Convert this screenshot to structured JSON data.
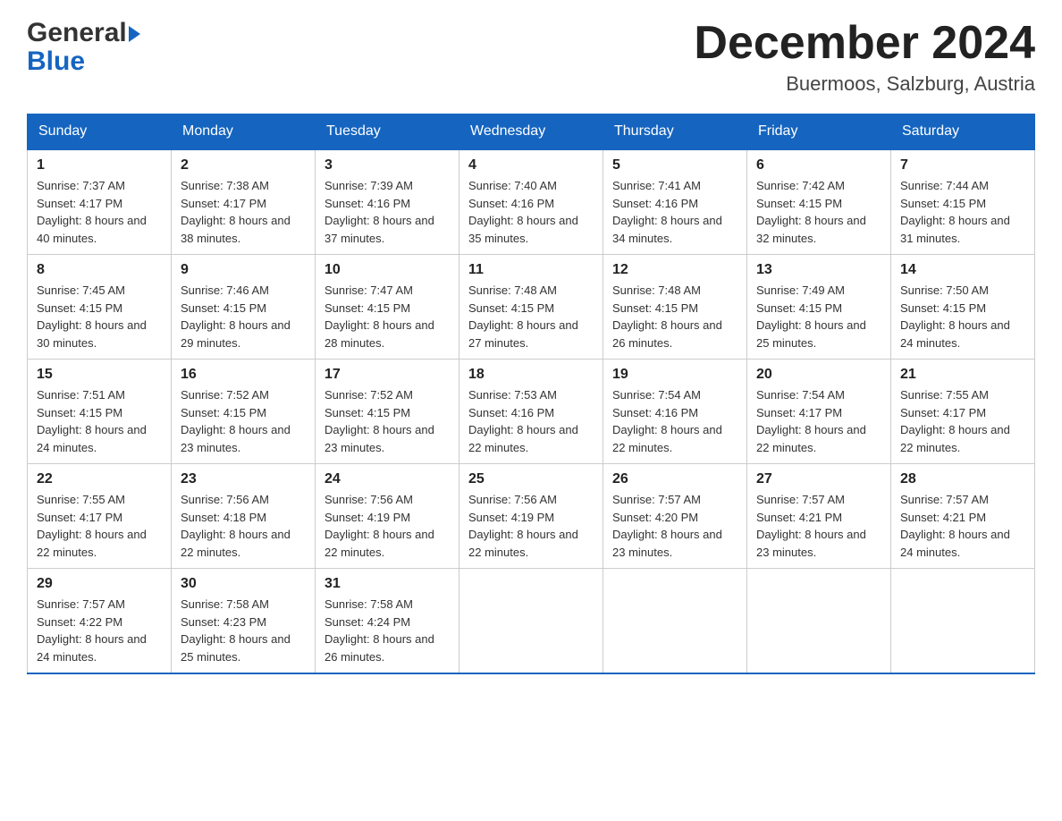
{
  "header": {
    "logo": {
      "general": "General",
      "blue": "Blue",
      "arrow": "▶"
    },
    "title": "December 2024",
    "location": "Buermoos, Salzburg, Austria"
  },
  "calendar": {
    "days_of_week": [
      "Sunday",
      "Monday",
      "Tuesday",
      "Wednesday",
      "Thursday",
      "Friday",
      "Saturday"
    ],
    "weeks": [
      [
        {
          "day": "1",
          "sunrise": "7:37 AM",
          "sunset": "4:17 PM",
          "daylight": "8 hours and 40 minutes."
        },
        {
          "day": "2",
          "sunrise": "7:38 AM",
          "sunset": "4:17 PM",
          "daylight": "8 hours and 38 minutes."
        },
        {
          "day": "3",
          "sunrise": "7:39 AM",
          "sunset": "4:16 PM",
          "daylight": "8 hours and 37 minutes."
        },
        {
          "day": "4",
          "sunrise": "7:40 AM",
          "sunset": "4:16 PM",
          "daylight": "8 hours and 35 minutes."
        },
        {
          "day": "5",
          "sunrise": "7:41 AM",
          "sunset": "4:16 PM",
          "daylight": "8 hours and 34 minutes."
        },
        {
          "day": "6",
          "sunrise": "7:42 AM",
          "sunset": "4:15 PM",
          "daylight": "8 hours and 32 minutes."
        },
        {
          "day": "7",
          "sunrise": "7:44 AM",
          "sunset": "4:15 PM",
          "daylight": "8 hours and 31 minutes."
        }
      ],
      [
        {
          "day": "8",
          "sunrise": "7:45 AM",
          "sunset": "4:15 PM",
          "daylight": "8 hours and 30 minutes."
        },
        {
          "day": "9",
          "sunrise": "7:46 AM",
          "sunset": "4:15 PM",
          "daylight": "8 hours and 29 minutes."
        },
        {
          "day": "10",
          "sunrise": "7:47 AM",
          "sunset": "4:15 PM",
          "daylight": "8 hours and 28 minutes."
        },
        {
          "day": "11",
          "sunrise": "7:48 AM",
          "sunset": "4:15 PM",
          "daylight": "8 hours and 27 minutes."
        },
        {
          "day": "12",
          "sunrise": "7:48 AM",
          "sunset": "4:15 PM",
          "daylight": "8 hours and 26 minutes."
        },
        {
          "day": "13",
          "sunrise": "7:49 AM",
          "sunset": "4:15 PM",
          "daylight": "8 hours and 25 minutes."
        },
        {
          "day": "14",
          "sunrise": "7:50 AM",
          "sunset": "4:15 PM",
          "daylight": "8 hours and 24 minutes."
        }
      ],
      [
        {
          "day": "15",
          "sunrise": "7:51 AM",
          "sunset": "4:15 PM",
          "daylight": "8 hours and 24 minutes."
        },
        {
          "day": "16",
          "sunrise": "7:52 AM",
          "sunset": "4:15 PM",
          "daylight": "8 hours and 23 minutes."
        },
        {
          "day": "17",
          "sunrise": "7:52 AM",
          "sunset": "4:15 PM",
          "daylight": "8 hours and 23 minutes."
        },
        {
          "day": "18",
          "sunrise": "7:53 AM",
          "sunset": "4:16 PM",
          "daylight": "8 hours and 22 minutes."
        },
        {
          "day": "19",
          "sunrise": "7:54 AM",
          "sunset": "4:16 PM",
          "daylight": "8 hours and 22 minutes."
        },
        {
          "day": "20",
          "sunrise": "7:54 AM",
          "sunset": "4:17 PM",
          "daylight": "8 hours and 22 minutes."
        },
        {
          "day": "21",
          "sunrise": "7:55 AM",
          "sunset": "4:17 PM",
          "daylight": "8 hours and 22 minutes."
        }
      ],
      [
        {
          "day": "22",
          "sunrise": "7:55 AM",
          "sunset": "4:17 PM",
          "daylight": "8 hours and 22 minutes."
        },
        {
          "day": "23",
          "sunrise": "7:56 AM",
          "sunset": "4:18 PM",
          "daylight": "8 hours and 22 minutes."
        },
        {
          "day": "24",
          "sunrise": "7:56 AM",
          "sunset": "4:19 PM",
          "daylight": "8 hours and 22 minutes."
        },
        {
          "day": "25",
          "sunrise": "7:56 AM",
          "sunset": "4:19 PM",
          "daylight": "8 hours and 22 minutes."
        },
        {
          "day": "26",
          "sunrise": "7:57 AM",
          "sunset": "4:20 PM",
          "daylight": "8 hours and 23 minutes."
        },
        {
          "day": "27",
          "sunrise": "7:57 AM",
          "sunset": "4:21 PM",
          "daylight": "8 hours and 23 minutes."
        },
        {
          "day": "28",
          "sunrise": "7:57 AM",
          "sunset": "4:21 PM",
          "daylight": "8 hours and 24 minutes."
        }
      ],
      [
        {
          "day": "29",
          "sunrise": "7:57 AM",
          "sunset": "4:22 PM",
          "daylight": "8 hours and 24 minutes."
        },
        {
          "day": "30",
          "sunrise": "7:58 AM",
          "sunset": "4:23 PM",
          "daylight": "8 hours and 25 minutes."
        },
        {
          "day": "31",
          "sunrise": "7:58 AM",
          "sunset": "4:24 PM",
          "daylight": "8 hours and 26 minutes."
        },
        null,
        null,
        null,
        null
      ]
    ]
  }
}
